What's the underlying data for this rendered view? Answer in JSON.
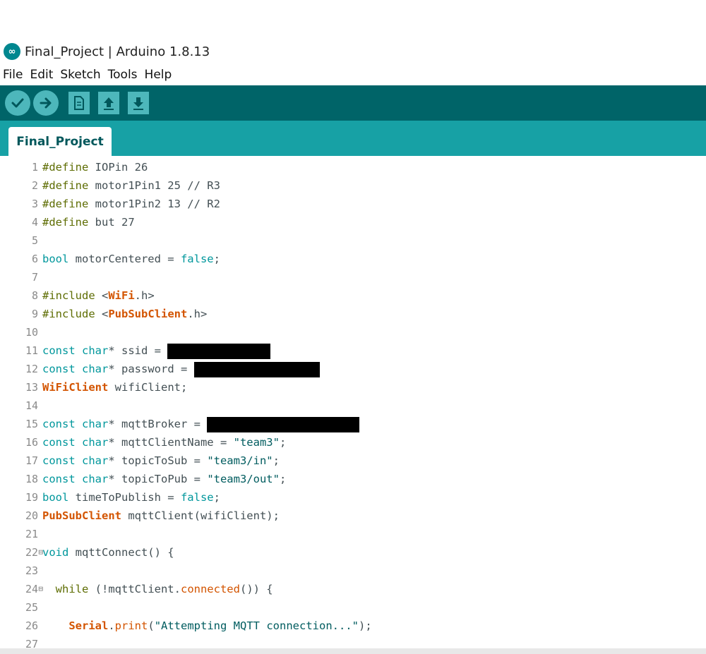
{
  "window": {
    "title": "Final_Project | Arduino 1.8.13",
    "logo_glyph": "∞"
  },
  "menu": [
    "File",
    "Edit",
    "Sketch",
    "Tools",
    "Help"
  ],
  "toolbar": {
    "verify_icon": "check-icon",
    "upload_icon": "arrow-right-icon",
    "new_icon": "new-file-icon",
    "open_icon": "arrow-up-icon",
    "save_icon": "arrow-down-icon"
  },
  "tabs": [
    {
      "label": "Final_Project"
    }
  ],
  "colors": {
    "toolbar": "#006468",
    "tab_strip": "#17a1a5",
    "button": "#4db7bb",
    "preprocessor": "#5e6d03",
    "type_keyword": "#00979c",
    "library_class": "#d35400"
  },
  "editor": {
    "line_numbers": [
      "1",
      "2",
      "3",
      "4",
      "5",
      "6",
      "7",
      "8",
      "9",
      "10",
      "11",
      "12",
      "13",
      "14",
      "15",
      "16",
      "17",
      "18",
      "19",
      "20",
      "21",
      "22",
      "23",
      "24",
      "25",
      "26",
      "27"
    ],
    "fold_markers": {
      "22": "⊟",
      "24": "⊟"
    },
    "code": {
      "l1_a": "#define",
      "l1_b": " IOPin 26",
      "l2_a": "#define",
      "l2_b": " motor1Pin1 25 // R3",
      "l3_a": "#define",
      "l3_b": " motor1Pin2 13 // R2",
      "l4_a": "#define",
      "l4_b": " but 27",
      "l6_a": "bool",
      "l6_b": " motorCentered = ",
      "l6_c": "false",
      "l6_d": ";",
      "l8_a": "#include",
      "l8_b": " <",
      "l8_c": "WiFi",
      "l8_d": ".h>",
      "l9_a": "#include",
      "l9_b": " <",
      "l9_c": "PubSubClient",
      "l9_d": ".h>",
      "l11_a": "const char",
      "l11_b": "* ssid = ",
      "l12_a": "const char",
      "l12_b": "* password = ",
      "l13_a": "WiFiClient",
      "l13_b": " wifiClient;",
      "l15_a": "const char",
      "l15_b": "* mqttBroker = ",
      "l16_a": "const char",
      "l16_b": "* mqttClientName = ",
      "l16_c": "\"team3\"",
      "l16_d": ";",
      "l17_a": "const char",
      "l17_b": "* topicToSub = ",
      "l17_c": "\"team3/in\"",
      "l17_d": ";",
      "l18_a": "const char",
      "l18_b": "* topicToPub = ",
      "l18_c": "\"team3/out\"",
      "l18_d": ";",
      "l19_a": "bool",
      "l19_b": " timeToPublish = ",
      "l19_c": "false",
      "l19_d": ";",
      "l20_a": "PubSubClient",
      "l20_b": " mqttClient(wifiClient);",
      "l22_a": "void",
      "l22_b": " mqttConnect() {",
      "l24_a": "  while",
      "l24_b": " (!mqttClient.",
      "l24_c": "connected",
      "l24_d": "()) {",
      "l26_a": "    ",
      "l26_b": "Serial",
      "l26_c": ".",
      "l26_d": "print",
      "l26_e": "(",
      "l26_f": "\"Attempting MQTT connection...\"",
      "l26_g": ");"
    }
  }
}
